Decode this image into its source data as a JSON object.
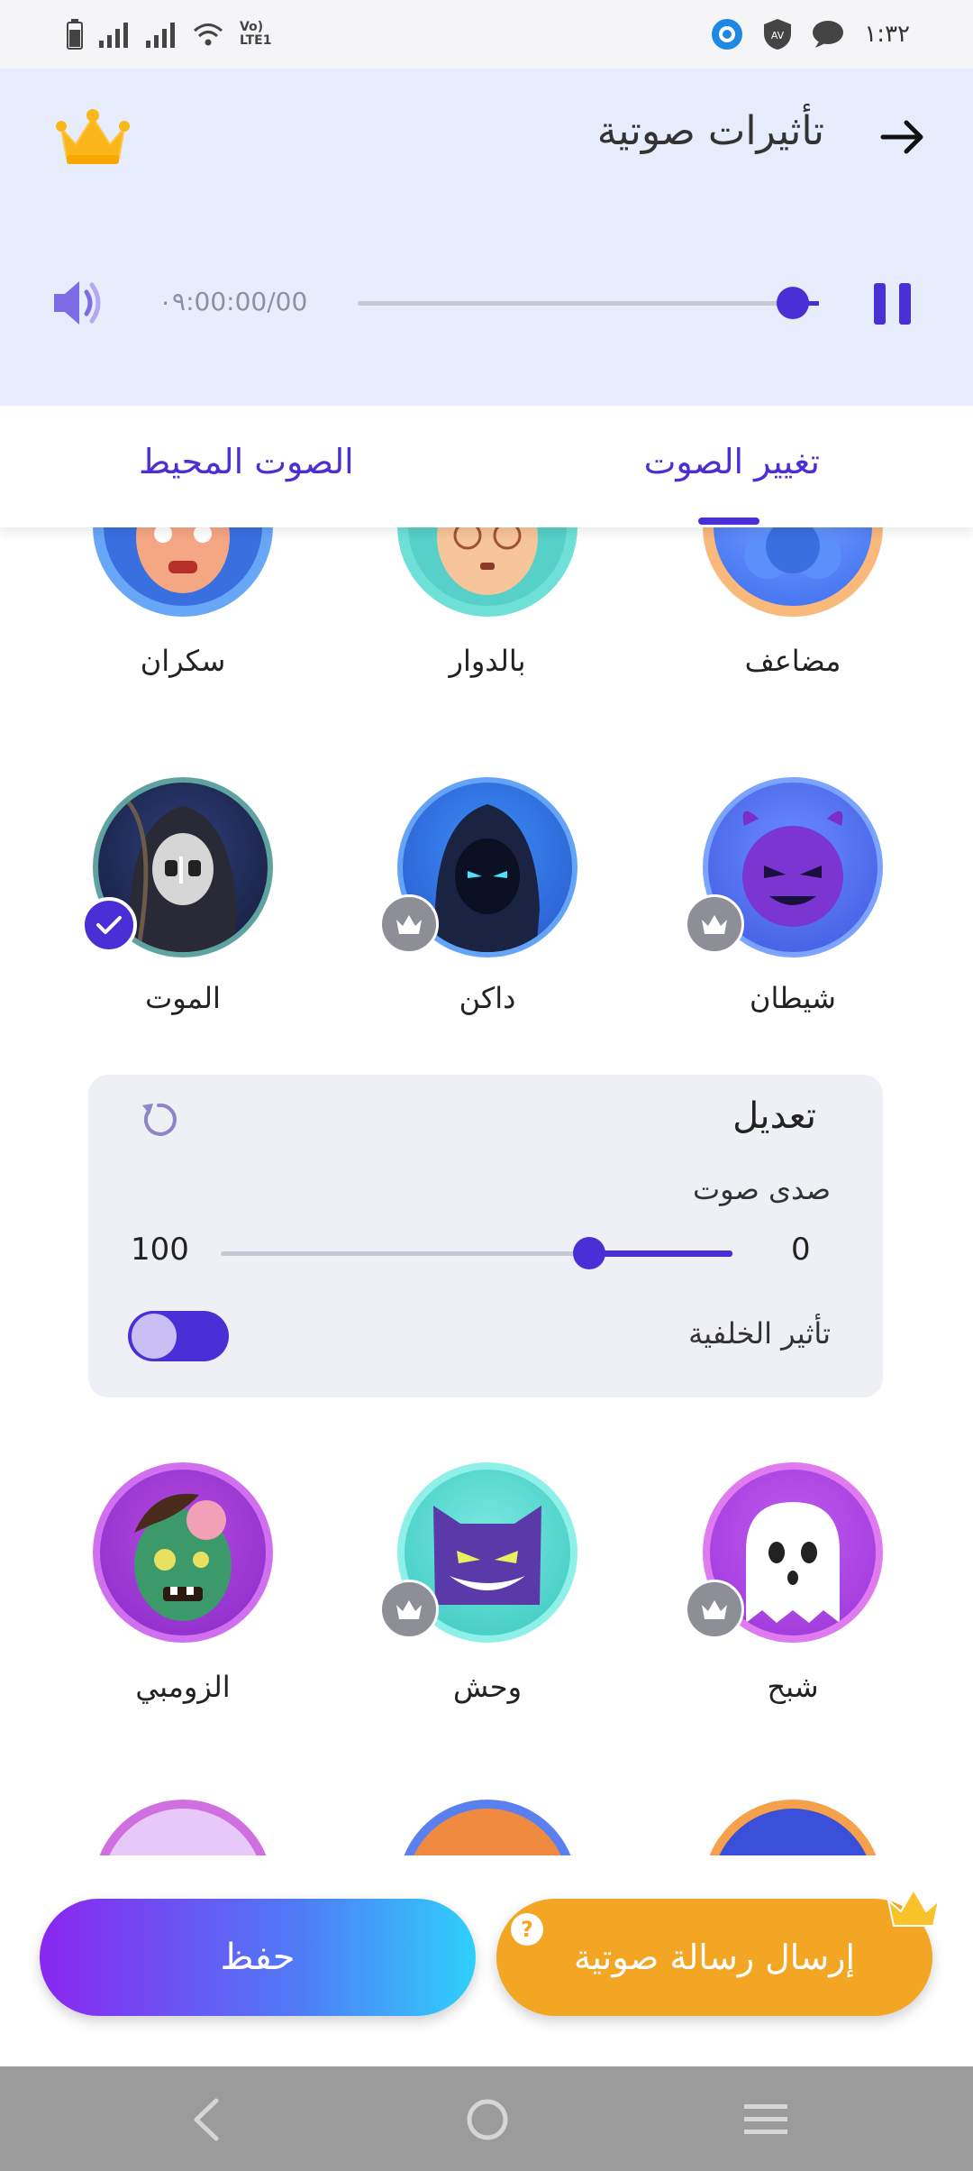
{
  "status_bar": {
    "time": "١:٣٢",
    "network_label_top": "Vo)",
    "network_label_bottom": "LTE1",
    "av_badge": "AV"
  },
  "header": {
    "title": "تأثيرات صوتية",
    "icons": [
      "back-arrow-icon",
      "crown-icon"
    ]
  },
  "player": {
    "time_display": "٠٩:00:00/00",
    "progress": 0.94,
    "state": "playing"
  },
  "tabs": [
    {
      "label": "تغيير الصوت",
      "active": true
    },
    {
      "label": "الصوت المحيط",
      "active": false
    }
  ],
  "effects_row_1": [
    {
      "label": "مضاعف",
      "icon": "clones-avatar"
    },
    {
      "label": "بالدوار",
      "icon": "dizzy-avatar"
    },
    {
      "label": "سكران",
      "icon": "drunk-avatar"
    }
  ],
  "effects_row_2": [
    {
      "label": "شيطان",
      "icon": "devil-avatar",
      "premium": true
    },
    {
      "label": "داكن",
      "icon": "dark-hood-avatar",
      "premium": true
    },
    {
      "label": "الموت",
      "icon": "reaper-avatar",
      "selected": true
    }
  ],
  "adjust_panel": {
    "title": "تعديل",
    "echo_label": "صدى صوت",
    "min": "0",
    "max": "100",
    "echo_value": 28,
    "background_label": "تأثير الخلفية",
    "background_on": true
  },
  "effects_row_3": [
    {
      "label": "شبح",
      "icon": "ghost-avatar",
      "premium": true
    },
    {
      "label": "وحش",
      "icon": "monster-avatar",
      "premium": true
    },
    {
      "label": "الزومبي",
      "icon": "zombie-avatar"
    }
  ],
  "buttons": {
    "save": "حفظ",
    "send": "إرسال رسالة صوتية",
    "help": "?"
  },
  "colors": {
    "accent": "#4a2fd6",
    "header_bg": "#e7edfc",
    "send": "#f2a623"
  }
}
